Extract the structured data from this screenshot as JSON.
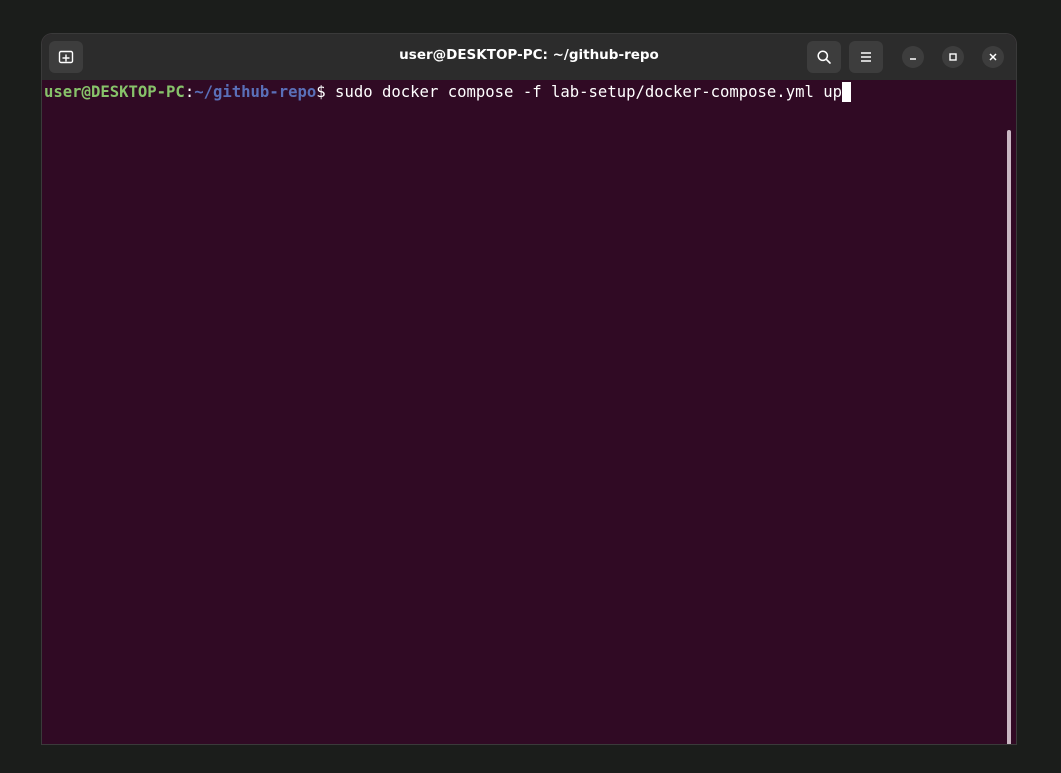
{
  "window": {
    "title": "user@DESKTOP-PC: ~/github-repo"
  },
  "titlebar": {
    "new_tab_icon": "new-tab-icon",
    "search_icon": "search-icon",
    "menu_icon": "hamburger-menu-icon",
    "minimize_icon": "minimize-icon",
    "maximize_icon": "maximize-icon",
    "close_icon": "close-icon"
  },
  "terminal": {
    "prompt_user_host": "user@DESKTOP-PC",
    "prompt_colon": ":",
    "prompt_path": "~/github-repo",
    "prompt_symbol": "$",
    "command": " sudo docker compose -f lab-setup/docker-compose.yml up"
  },
  "colors": {
    "terminal_background": "#300a24",
    "titlebar_background": "#2c2c2c",
    "prompt_user_color": "#87c26a",
    "prompt_path_color": "#5a6fb8"
  }
}
